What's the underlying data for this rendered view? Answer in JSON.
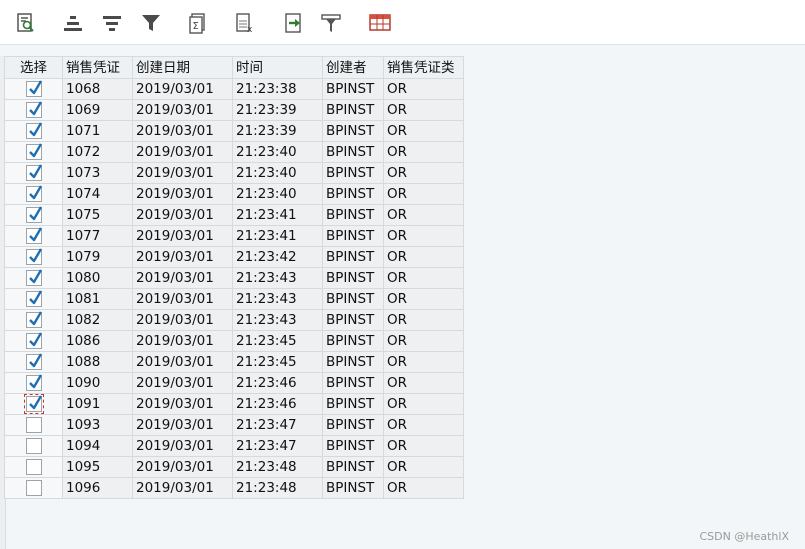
{
  "toolbar": {
    "buttons": [
      {
        "name": "details-icon"
      },
      {
        "name": "sort-ascending-icon"
      },
      {
        "name": "sort-descending-icon"
      },
      {
        "name": "filter-icon"
      },
      {
        "name": "calculate-total-icon"
      },
      {
        "name": "subtotal-icon"
      },
      {
        "name": "export-icon"
      },
      {
        "name": "print-preview-icon"
      },
      {
        "name": "change-layout-icon"
      }
    ],
    "accent_color": "#1f6fb2"
  },
  "table": {
    "columns": [
      "选择",
      "销售凭证",
      "创建日期",
      "时间",
      "创建者",
      "销售凭证类"
    ],
    "rows": [
      {
        "selected": true,
        "doc": "1068",
        "date": "2019/03/01",
        "time": "21:23:38",
        "creator": "BPINST",
        "type": "OR"
      },
      {
        "selected": true,
        "doc": "1069",
        "date": "2019/03/01",
        "time": "21:23:39",
        "creator": "BPINST",
        "type": "OR"
      },
      {
        "selected": true,
        "doc": "1071",
        "date": "2019/03/01",
        "time": "21:23:39",
        "creator": "BPINST",
        "type": "OR"
      },
      {
        "selected": true,
        "doc": "1072",
        "date": "2019/03/01",
        "time": "21:23:40",
        "creator": "BPINST",
        "type": "OR"
      },
      {
        "selected": true,
        "doc": "1073",
        "date": "2019/03/01",
        "time": "21:23:40",
        "creator": "BPINST",
        "type": "OR"
      },
      {
        "selected": true,
        "doc": "1074",
        "date": "2019/03/01",
        "time": "21:23:40",
        "creator": "BPINST",
        "type": "OR"
      },
      {
        "selected": true,
        "doc": "1075",
        "date": "2019/03/01",
        "time": "21:23:41",
        "creator": "BPINST",
        "type": "OR"
      },
      {
        "selected": true,
        "doc": "1077",
        "date": "2019/03/01",
        "time": "21:23:41",
        "creator": "BPINST",
        "type": "OR"
      },
      {
        "selected": true,
        "doc": "1079",
        "date": "2019/03/01",
        "time": "21:23:42",
        "creator": "BPINST",
        "type": "OR"
      },
      {
        "selected": true,
        "doc": "1080",
        "date": "2019/03/01",
        "time": "21:23:43",
        "creator": "BPINST",
        "type": "OR"
      },
      {
        "selected": true,
        "doc": "1081",
        "date": "2019/03/01",
        "time": "21:23:43",
        "creator": "BPINST",
        "type": "OR"
      },
      {
        "selected": true,
        "doc": "1082",
        "date": "2019/03/01",
        "time": "21:23:43",
        "creator": "BPINST",
        "type": "OR"
      },
      {
        "selected": true,
        "doc": "1086",
        "date": "2019/03/01",
        "time": "21:23:45",
        "creator": "BPINST",
        "type": "OR"
      },
      {
        "selected": true,
        "doc": "1088",
        "date": "2019/03/01",
        "time": "21:23:45",
        "creator": "BPINST",
        "type": "OR"
      },
      {
        "selected": true,
        "doc": "1090",
        "date": "2019/03/01",
        "time": "21:23:46",
        "creator": "BPINST",
        "type": "OR"
      },
      {
        "selected": true,
        "focused": true,
        "doc": "1091",
        "date": "2019/03/01",
        "time": "21:23:46",
        "creator": "BPINST",
        "type": "OR"
      },
      {
        "selected": false,
        "doc": "1093",
        "date": "2019/03/01",
        "time": "21:23:47",
        "creator": "BPINST",
        "type": "OR"
      },
      {
        "selected": false,
        "doc": "1094",
        "date": "2019/03/01",
        "time": "21:23:47",
        "creator": "BPINST",
        "type": "OR"
      },
      {
        "selected": false,
        "doc": "1095",
        "date": "2019/03/01",
        "time": "21:23:48",
        "creator": "BPINST",
        "type": "OR"
      },
      {
        "selected": false,
        "doc": "1096",
        "date": "2019/03/01",
        "time": "21:23:48",
        "creator": "BPINST",
        "type": "OR"
      }
    ]
  },
  "watermark": "CSDN @HeathlX"
}
